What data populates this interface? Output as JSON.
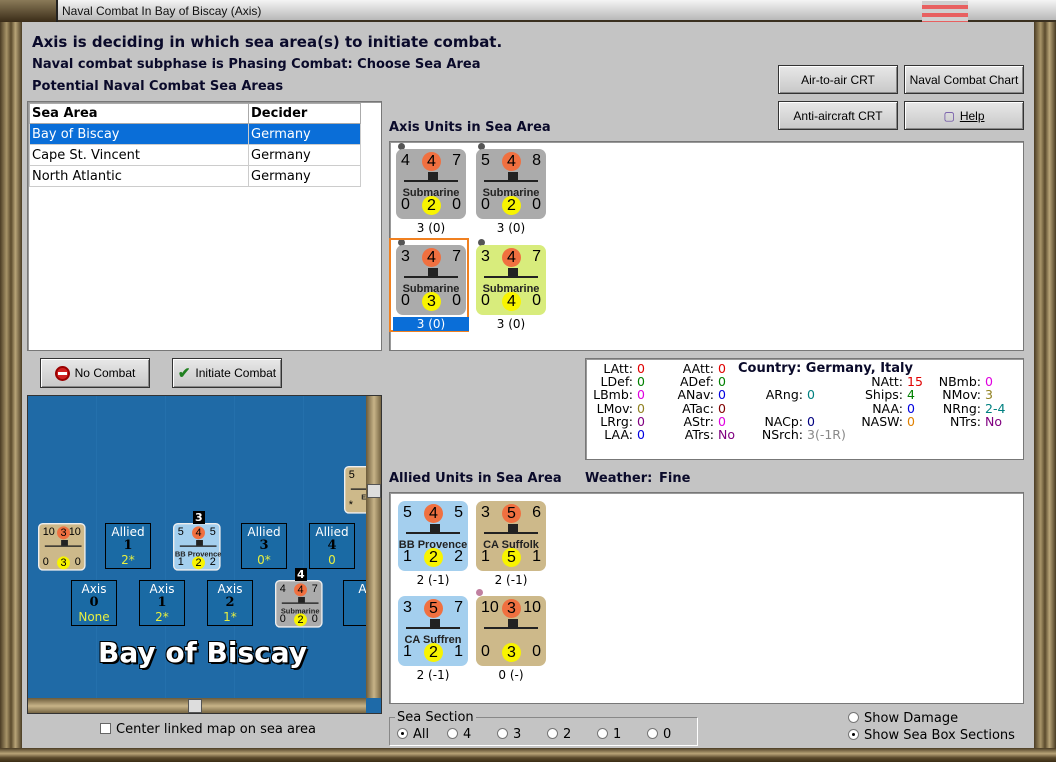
{
  "window": {
    "title": "Naval Combat In Bay of Biscay (Axis)"
  },
  "header": {
    "status": "Axis is deciding in which sea area(s) to initiate combat.",
    "subphase": "Naval combat subphase is Phasing Combat: Choose Sea Area",
    "areas_label": "Potential Naval Combat Sea Areas"
  },
  "sea_table": {
    "headers": [
      "Sea Area",
      "Decider"
    ],
    "rows": [
      [
        "Bay of Biscay",
        "Germany"
      ],
      [
        "Cape St. Vincent",
        "Germany"
      ],
      [
        "North Atlantic",
        "Germany"
      ]
    ],
    "selected": 0
  },
  "buttons": {
    "air_to_air": "Air-to-air CRT",
    "naval_chart": "Naval Combat Chart",
    "anti_aircraft": "Anti-aircraft CRT",
    "help": "Help",
    "no_combat": "No Combat",
    "initiate": "Initiate Combat"
  },
  "axis_units": {
    "label": "Axis Units in Sea Area",
    "units": [
      {
        "tl": "4",
        "tc": "4",
        "tr": "7",
        "name": "Submarine",
        "bl": "0",
        "bc": "2",
        "br": "0",
        "caption": "3 (0)",
        "color": "#ababab"
      },
      {
        "tl": "5",
        "tc": "4",
        "tr": "8",
        "name": "Submarine",
        "bl": "0",
        "bc": "2",
        "br": "0",
        "caption": "3 (0)",
        "color": "#ababab"
      },
      {
        "tl": "3",
        "tc": "4",
        "tr": "7",
        "name": "Submarine",
        "bl": "0",
        "bc": "3",
        "br": "0",
        "caption": "3 (0)",
        "color": "#ababab",
        "selected": true
      },
      {
        "tl": "3",
        "tc": "4",
        "tr": "7",
        "name": "Submarine",
        "bl": "0",
        "bc": "4",
        "br": "0",
        "caption": "3 (0)",
        "color": "#d8ec7c"
      }
    ]
  },
  "stats": {
    "country_label": "Country: Germany, Italy",
    "items": [
      [
        "LAtt:",
        "0",
        "#e00000"
      ],
      [
        "LDef:",
        "0",
        "#008000"
      ],
      [
        "LBmb:",
        "0",
        "#e000e0"
      ],
      [
        "LMov:",
        "0",
        "#908020"
      ],
      [
        "LRrg:",
        "0",
        "#800080"
      ],
      [
        "LAA:",
        "0",
        "#0000e0"
      ],
      [
        "AAtt:",
        "0",
        "#e00000"
      ],
      [
        "ADef:",
        "0",
        "#008000"
      ],
      [
        "ANav:",
        "0",
        "#0000e0"
      ],
      [
        "ATac:",
        "0",
        "#800000"
      ],
      [
        "AStr:",
        "0",
        "#e000e0"
      ],
      [
        "ATrs:",
        "No",
        "#800080"
      ],
      [
        "ARng:",
        "0",
        "#008080"
      ],
      [
        "NACp:",
        "0",
        "#000080"
      ],
      [
        "NSrch:",
        "3(-1R)",
        "#888888"
      ],
      [
        "NAtt:",
        "15",
        "#e00000"
      ],
      [
        "Ships:",
        "4",
        "#008000"
      ],
      [
        "NAA:",
        "0",
        "#0000e0"
      ],
      [
        "NASW:",
        "0",
        "#e08000"
      ],
      [
        "NBmb:",
        "0",
        "#e000e0"
      ],
      [
        "NMov:",
        "3",
        "#908020"
      ],
      [
        "NRng:",
        "2-4",
        "#008080"
      ],
      [
        "NTrs:",
        "No",
        "#800080"
      ]
    ]
  },
  "allied_units": {
    "label": "Allied Units in Sea Area",
    "weather_label": "Weather:",
    "weather": "Fine",
    "units": [
      {
        "tl": "5",
        "tc": "4",
        "tr": "5",
        "name": "BB Provence",
        "bl": "1",
        "bc": "2",
        "br": "2",
        "caption": "2 (-1)",
        "color": "#a4cfee"
      },
      {
        "tl": "3",
        "tc": "5",
        "tr": "6",
        "name": "CA Suffolk",
        "bl": "1",
        "bc": "5",
        "br": "1",
        "caption": "2 (-1)",
        "color": "#cdb98a"
      },
      {
        "tl": "3",
        "tc": "5",
        "tr": "7",
        "name": "CA Suffren",
        "bl": "1",
        "bc": "2",
        "br": "1",
        "caption": "2 (-1)",
        "color": "#a4cfee"
      },
      {
        "tl": "10",
        "tc": "3",
        "tr": "10",
        "name": "",
        "bl": "0",
        "bc": "3",
        "br": "0",
        "caption": "0 (-)",
        "color": "#cdb98a"
      }
    ]
  },
  "map": {
    "title": "Bay of Biscay",
    "allied_boxes": [
      {
        "side": "Allied",
        "num": "1",
        "val": "2*"
      },
      {
        "side": "Allied",
        "num": "3",
        "val": "0*"
      },
      {
        "side": "Allied",
        "num": "4",
        "val": "0"
      }
    ],
    "axis_boxes": [
      {
        "side": "Axis",
        "num": "0",
        "val": "None"
      },
      {
        "side": "Axis",
        "num": "1",
        "val": "2*"
      },
      {
        "side": "Axis",
        "num": "2",
        "val": "1*"
      },
      {
        "side": "Ax",
        "num": "",
        "val": ""
      }
    ],
    "counters": [
      {
        "tl": "10",
        "tc": "3",
        "tr": "10",
        "name": "",
        "bl": "0",
        "bc": "3",
        "br": "0",
        "color": "#cdb98a"
      },
      {
        "tl": "5",
        "tc": "4",
        "tr": "5",
        "name": "BB Provence",
        "bl": "1",
        "bc": "2",
        "br": "2",
        "color": "#a4cfee",
        "badge": "3"
      },
      {
        "tl": "4",
        "tc": "4",
        "tr": "7",
        "name": "Submarine",
        "bl": "0",
        "bc": "2",
        "br": "0",
        "color": "#ababab",
        "badge": "4"
      },
      {
        "tl": "5",
        "tc": "",
        "tr": "",
        "name": "Emil",
        "bl": "*",
        "bc": "",
        "br": "",
        "color": "#cdb98a"
      }
    ]
  },
  "center_map": {
    "label": "Center linked map on sea area",
    "checked": false
  },
  "sea_section": {
    "label": "Sea Section",
    "options": [
      "All",
      "4",
      "3",
      "2",
      "1",
      "0"
    ],
    "selected": "All"
  },
  "view_options": {
    "show_damage": "Show Damage",
    "show_sections": "Show Sea Box Sections",
    "selected": "Show Sea Box Sections"
  }
}
